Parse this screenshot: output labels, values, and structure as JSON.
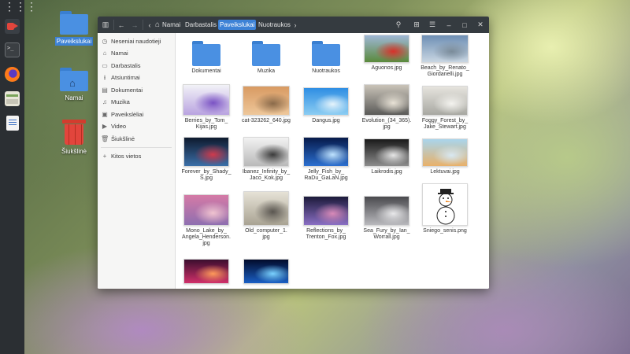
{
  "dock": {
    "apps_icon": "grid-icon",
    "items": [
      "video-app-icon",
      "terminal-icon",
      "firefox-icon",
      "files-app-icon",
      "text-editor-icon"
    ]
  },
  "desktop": {
    "icons": [
      {
        "label": "Paveikslukai",
        "icon": "folder-icon",
        "selected": true
      },
      {
        "label": "Namai",
        "icon": "home-folder-icon"
      },
      {
        "label": "Šiukšlinė",
        "icon": "trash-icon"
      }
    ]
  },
  "window": {
    "breadcrumbs": [
      "Namai",
      "Darbastalis",
      "Paveikslukai",
      "Nuotraukos"
    ],
    "active_crumb": "Paveikslukai",
    "controls": [
      "search-icon",
      "view-grid-icon",
      "menu-icon",
      "minimize-icon",
      "maximize-icon",
      "close-icon"
    ]
  },
  "sidebar": {
    "items": [
      {
        "label": "Neseniai naudotieji",
        "icon": "clock-icon"
      },
      {
        "label": "Namai",
        "icon": "home-icon"
      },
      {
        "label": "Darbastalis",
        "icon": "desktop-icon"
      },
      {
        "label": "Atsiuntimai",
        "icon": "download-icon"
      },
      {
        "label": "Dokumentai",
        "icon": "document-icon"
      },
      {
        "label": "Muzika",
        "icon": "music-icon"
      },
      {
        "label": "Paveikslėliai",
        "icon": "pictures-icon"
      },
      {
        "label": "Video",
        "icon": "video-icon"
      },
      {
        "label": "Šiukšlinė",
        "icon": "trash-icon"
      },
      {
        "label": "Kitos vietos",
        "icon": "plus-icon"
      }
    ]
  },
  "files": [
    {
      "name": "Dokumentai",
      "type": "folder"
    },
    {
      "name": "Muzika",
      "type": "folder"
    },
    {
      "name": "Nuotraukos",
      "type": "folder"
    },
    {
      "name": "Aguonos.jpg",
      "type": "image",
      "colors": [
        "#9fb7d6",
        "#5a8a3c",
        "#d8312a"
      ]
    },
    {
      "name": "Beach_by_Renato_\nGiordanelli.jpg",
      "type": "image",
      "colors": [
        "#6e8fb4",
        "#c9d6e2",
        "#7a8b99"
      ]
    },
    {
      "name": "Berries_by_Tom_\nKijas.jpg",
      "type": "image",
      "colors": [
        "#f2f2f7",
        "#b9a3e0",
        "#7a52c4"
      ]
    },
    {
      "name": "cat-323262_640.jpg",
      "type": "image",
      "colors": [
        "#d89a62",
        "#eec79a",
        "#8a6a4a"
      ]
    },
    {
      "name": "Dangus.jpg",
      "type": "image",
      "colors": [
        "#2f8ee3",
        "#8ccdf2",
        "#e6f4fb"
      ]
    },
    {
      "name": "Evolution_(34_365).\njpg",
      "type": "image",
      "colors": [
        "#c9c3b8",
        "#5a5a58",
        "#e8e2d6"
      ]
    },
    {
      "name": "Foggy_Forest_by_\nJake_Stewart.jpg",
      "type": "image",
      "colors": [
        "#e6e4de",
        "#a8a8a2",
        "#f4f3ef"
      ]
    },
    {
      "name": "Forever_by_Shady_\nS.jpg",
      "type": "image",
      "colors": [
        "#0e1a2e",
        "#3b6fa8",
        "#d03a4c"
      ]
    },
    {
      "name": "Ibanez_Infinity_by_\nJaco_Kok.jpg",
      "type": "image",
      "colors": [
        "#f2f2f2",
        "#b9b9b9",
        "#3a3a3a"
      ]
    },
    {
      "name": "Jelly_Fish_by_\nRaDu_GaLaN.jpg",
      "type": "image",
      "colors": [
        "#061a4a",
        "#2b6fd0",
        "#bfe3ff"
      ]
    },
    {
      "name": "Laikrodis.jpg",
      "type": "image",
      "colors": [
        "#1a1a1a",
        "#8c8c8c",
        "#e6e6e6"
      ]
    },
    {
      "name": "Lektuvai.jpg",
      "type": "image",
      "colors": [
        "#a9d5ec",
        "#e8b16a",
        "#d8e8f2"
      ]
    },
    {
      "name": "Mono_Lake_by_\nAngela_Henderson.\njpg",
      "type": "image",
      "colors": [
        "#d57aa6",
        "#8e6fb0",
        "#f0c4d0"
      ]
    },
    {
      "name": "Old_computer_1.\njpg",
      "type": "image",
      "colors": [
        "#e6e2d6",
        "#a9a393",
        "#5a5650"
      ]
    },
    {
      "name": "Reflections_by_\nTrenton_Fox.jpg",
      "type": "image",
      "colors": [
        "#1c1a3a",
        "#8a6fc4",
        "#d88ab8"
      ]
    },
    {
      "name": "Sea_Fury_by_Ian_\nWorrall.jpg",
      "type": "image",
      "colors": [
        "#4a4a4e",
        "#b9b9bd",
        "#e8e8ea"
      ]
    },
    {
      "name": "Sniego_senis.png",
      "type": "snowman",
      "colors": [
        "#ffffff",
        "#222222",
        "#f08a24"
      ]
    },
    {
      "name": "",
      "type": "image",
      "colors": [
        "#3a0e2e",
        "#d0306a",
        "#ff9a5a"
      ]
    },
    {
      "name": "",
      "type": "image",
      "colors": [
        "#020b2a",
        "#1a5fc4",
        "#7ad2ff"
      ]
    }
  ]
}
